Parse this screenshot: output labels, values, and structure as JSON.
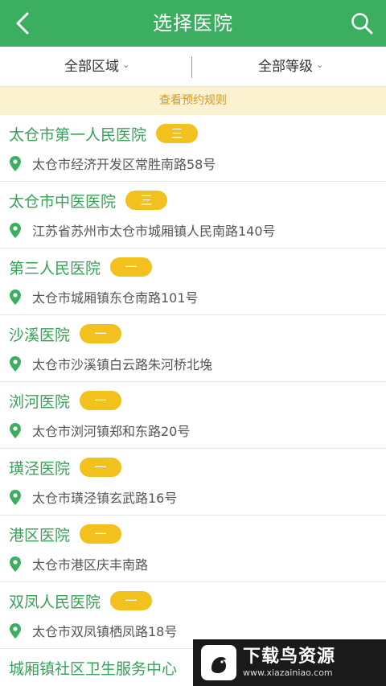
{
  "header": {
    "title": "选择医院",
    "back_icon": "chevron-left-icon",
    "search_icon": "search-icon",
    "color": "#3cae5f"
  },
  "filters": {
    "area_label": "全部区域",
    "level_label": "全部等级"
  },
  "notice": {
    "text": "查看预约规则"
  },
  "hospitals": [
    {
      "name": "太仓市第一人民医院",
      "level": "三",
      "address": "太仓市经济开发区常胜南路58号"
    },
    {
      "name": "太仓市中医医院",
      "level": "三",
      "address": "江苏省苏州市太仓市城厢镇人民南路140号"
    },
    {
      "name": "第三人民医院",
      "level": "一",
      "address": "太仓市城厢镇东仓南路101号"
    },
    {
      "name": "沙溪医院",
      "level": "一",
      "address": "太仓市沙溪镇白云路朱河桥北堍"
    },
    {
      "name": "浏河医院",
      "level": "一",
      "address": "太仓市浏河镇郑和东路20号"
    },
    {
      "name": "璜泾医院",
      "level": "一",
      "address": "太仓市璜泾镇玄武路16号"
    },
    {
      "name": "港区医院",
      "level": "一",
      "address": "太仓市港区庆丰南路"
    },
    {
      "name": "双凤人民医院",
      "level": "一",
      "address": "太仓市双凤镇栖凤路18号"
    },
    {
      "name": "城厢镇社区卫生服务中心",
      "level": "",
      "address": ""
    }
  ],
  "watermark": {
    "title": "下载鸟资源",
    "url": "www.xiazainiao.com"
  },
  "colors": {
    "accent": "#3cae5f",
    "badge": "#f2c11e",
    "notice_bg": "#fbf3cf",
    "notice_text": "#d9981f"
  }
}
